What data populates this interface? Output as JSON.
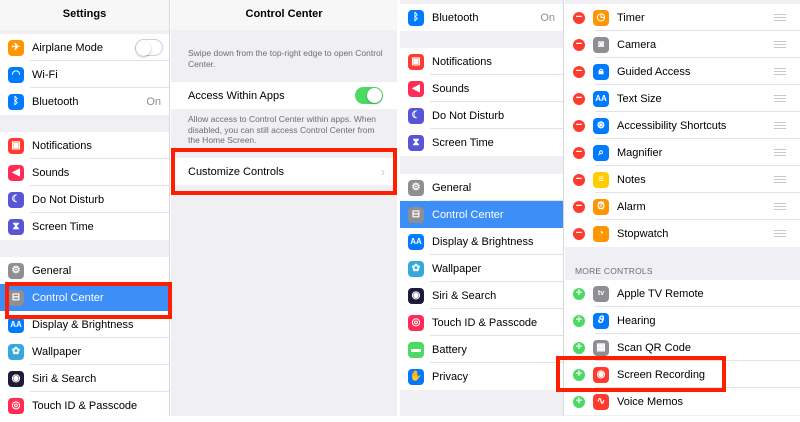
{
  "panel1": {
    "title": "Settings",
    "group1": [
      {
        "label": "Airplane Mode",
        "icon": "airplane-icon",
        "toggle": "off"
      },
      {
        "label": "Wi-Fi",
        "icon": "wifi-icon"
      },
      {
        "label": "Bluetooth",
        "icon": "bluetooth-icon",
        "value": "On"
      }
    ],
    "group2": [
      {
        "label": "Notifications",
        "icon": "notifications-icon"
      },
      {
        "label": "Sounds",
        "icon": "sounds-icon"
      },
      {
        "label": "Do Not Disturb",
        "icon": "moon-icon"
      },
      {
        "label": "Screen Time",
        "icon": "hourglass-icon"
      }
    ],
    "group3": [
      {
        "label": "General",
        "icon": "gear-icon"
      },
      {
        "label": "Control Center",
        "icon": "switches-icon",
        "selected": true
      },
      {
        "label": "Display & Brightness",
        "icon": "text-size-icon"
      },
      {
        "label": "Wallpaper",
        "icon": "flower-icon"
      },
      {
        "label": "Siri & Search",
        "icon": "siri-icon"
      },
      {
        "label": "Touch ID & Passcode",
        "icon": "fingerprint-icon"
      }
    ]
  },
  "panel2": {
    "title": "Control Center",
    "intro": "Swipe down from the top-right edge to open Control Center.",
    "access_label": "Access Within Apps",
    "access_toggle": "on",
    "access_note": "Allow access to Control Center within apps. When disabled, you can still access Control Center from the Home Screen.",
    "customize_label": "Customize Controls",
    "chevron": "›"
  },
  "panel3": {
    "top": [
      {
        "label": "Bluetooth",
        "icon": "bluetooth-icon",
        "value": "On"
      }
    ],
    "group2": [
      {
        "label": "Notifications",
        "icon": "notifications-icon"
      },
      {
        "label": "Sounds",
        "icon": "sounds-icon"
      },
      {
        "label": "Do Not Disturb",
        "icon": "moon-icon"
      },
      {
        "label": "Screen Time",
        "icon": "hourglass-icon"
      }
    ],
    "group3": [
      {
        "label": "General",
        "icon": "gear-icon"
      },
      {
        "label": "Control Center",
        "icon": "switches-icon",
        "selected": true
      },
      {
        "label": "Display & Brightness",
        "icon": "text-size-icon"
      },
      {
        "label": "Wallpaper",
        "icon": "flower-icon"
      },
      {
        "label": "Siri & Search",
        "icon": "siri-icon"
      },
      {
        "label": "Touch ID & Passcode",
        "icon": "fingerprint-icon"
      },
      {
        "label": "Battery",
        "icon": "battery-icon"
      },
      {
        "label": "Privacy",
        "icon": "hand-icon"
      }
    ]
  },
  "panel4": {
    "included": [
      {
        "label": "Timer",
        "icon": "timer-icon"
      },
      {
        "label": "Camera",
        "icon": "camera-icon"
      },
      {
        "label": "Guided Access",
        "icon": "lock-icon"
      },
      {
        "label": "Text Size",
        "icon": "text-size-icon"
      },
      {
        "label": "Accessibility Shortcuts",
        "icon": "accessibility-icon"
      },
      {
        "label": "Magnifier",
        "icon": "magnifier-icon"
      },
      {
        "label": "Notes",
        "icon": "notes-icon"
      },
      {
        "label": "Alarm",
        "icon": "alarm-icon"
      },
      {
        "label": "Stopwatch",
        "icon": "stopwatch-icon"
      }
    ],
    "more_label": "MORE CONTROLS",
    "more": [
      {
        "label": "Apple TV Remote",
        "icon": "tv-remote-icon"
      },
      {
        "label": "Hearing",
        "icon": "ear-icon"
      },
      {
        "label": "Scan QR Code",
        "icon": "qr-code-icon"
      },
      {
        "label": "Screen Recording",
        "icon": "record-icon"
      },
      {
        "label": "Voice Memos",
        "icon": "waveform-icon"
      }
    ]
  },
  "colors": {
    "selected": "#3d8ef7",
    "highlight": "#ff1e00",
    "toggle_on": "#4cd964",
    "remove": "#ff3b30",
    "add": "#4cd964"
  }
}
